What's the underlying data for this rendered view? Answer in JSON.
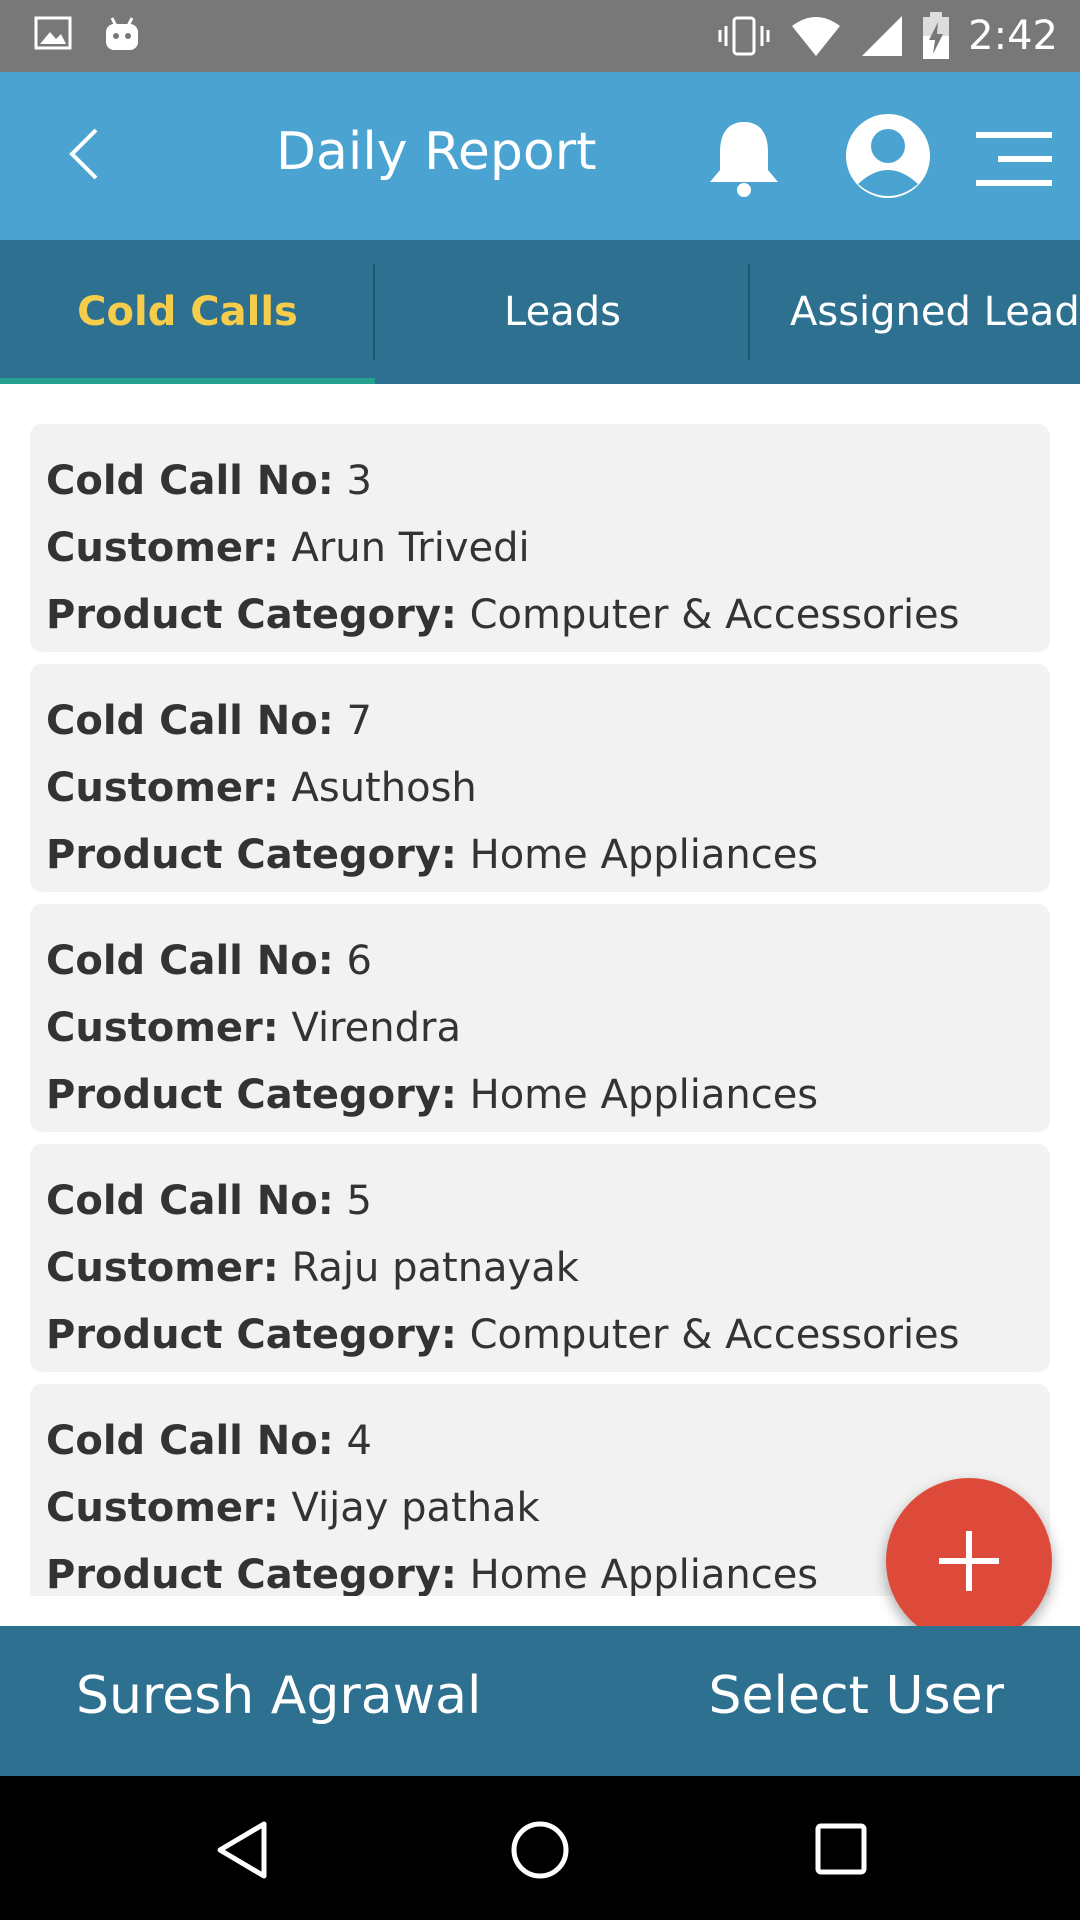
{
  "status_bar": {
    "time": "2:42"
  },
  "app_bar": {
    "title": "Daily Report"
  },
  "tabs": [
    {
      "label": "Cold Calls",
      "active": true
    },
    {
      "label": "Leads",
      "active": false
    },
    {
      "label": "Assigned Lead",
      "active": false
    }
  ],
  "labels": {
    "cold_call_no": "Cold Call No:",
    "customer": "Customer:",
    "product_category": "Product Category:"
  },
  "cold_calls": [
    {
      "number": "3",
      "customer": "Arun Trivedi",
      "category": "Computer & Accessories"
    },
    {
      "number": "7",
      "customer": "Asuthosh",
      "category": "Home Appliances"
    },
    {
      "number": "6",
      "customer": "Virendra",
      "category": "Home Appliances"
    },
    {
      "number": "5",
      "customer": "Raju patnayak",
      "category": "Computer & Accessories"
    },
    {
      "number": "4",
      "customer": "Vijay pathak",
      "category": "Home Appliances"
    }
  ],
  "bottom_bar": {
    "user_name": "Suresh Agrawal",
    "select_label": "Select User"
  },
  "colors": {
    "app_bar": "#4aa3d1",
    "tab_bar": "#2e7090",
    "active_tab": "#f5cd4b",
    "indicator": "#24a08c",
    "fab": "#de4a3a"
  },
  "icons": [
    "image-icon",
    "android-icon",
    "vibrate-icon",
    "wifi-icon",
    "signal-icon",
    "battery-icon",
    "back-icon",
    "bell-icon",
    "profile-icon",
    "menu-icon",
    "plus-icon",
    "nav-back-icon",
    "nav-home-icon",
    "nav-recents-icon"
  ]
}
